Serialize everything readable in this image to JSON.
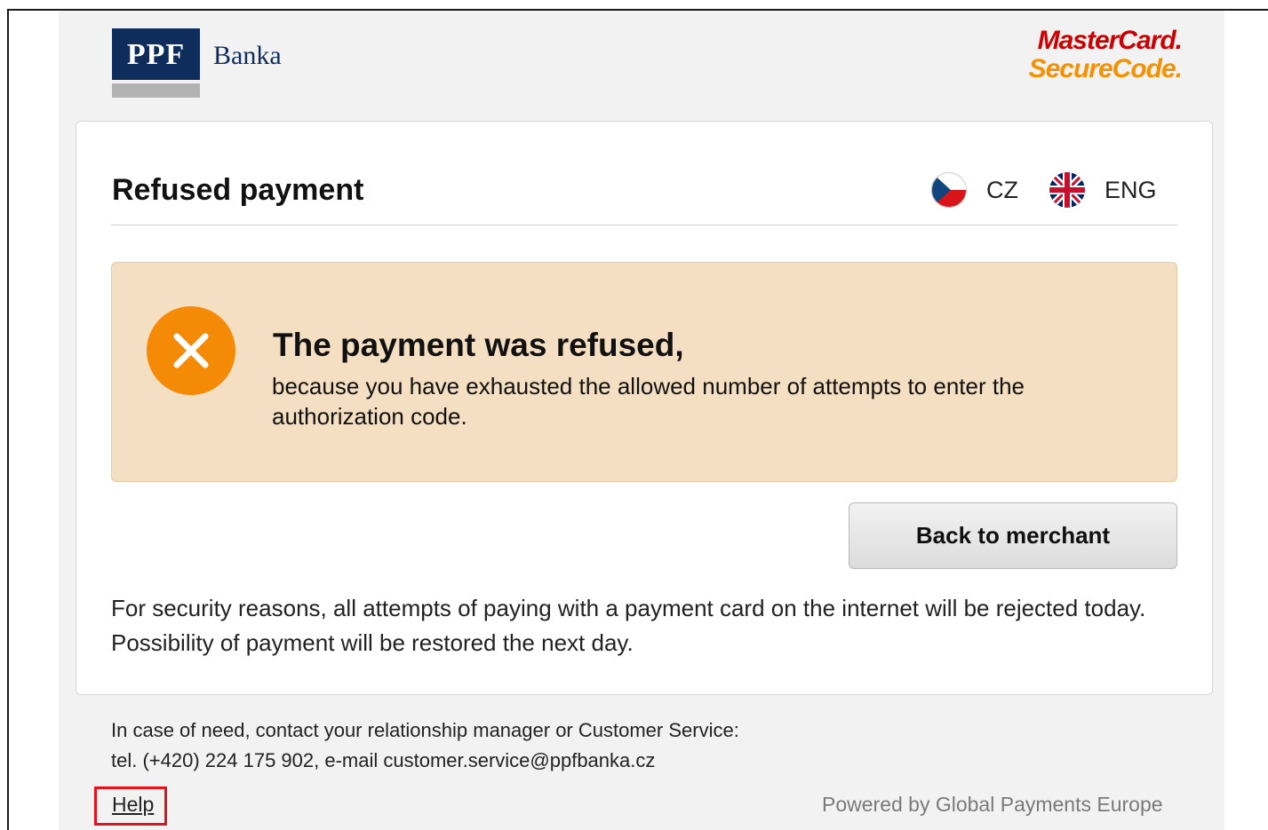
{
  "header": {
    "bank_logo_text": "PPF",
    "bank_name": "Banka",
    "mastercard_line1": "MasterCard.",
    "mastercard_line2": "SecureCode."
  },
  "card": {
    "title": "Refused payment",
    "languages": [
      {
        "code": "CZ",
        "flag_icon": "czech-flag-icon"
      },
      {
        "code": "ENG",
        "flag_icon": "uk-flag-icon"
      }
    ],
    "alert": {
      "icon": "close-icon",
      "title": "The payment was refused,",
      "text": "because you have exhausted the allowed number of attempts to enter the authorization code."
    },
    "back_button_label": "Back to merchant",
    "security_note": "For security reasons, all attempts of paying with a payment card on the internet will be rejected today. Possibility of payment will be restored the next day."
  },
  "footer": {
    "contact_line1": "In case of need, contact your relationship manager or Customer Service:",
    "contact_line2": "tel. (+420) 224 175 902, e-mail customer.service@ppfbanka.cz",
    "help_label": "Help",
    "powered_by": "Powered by Global Payments Europe"
  },
  "colors": {
    "bank_blue": "#0f2d5c",
    "alert_background": "#f5dfc2",
    "alert_icon": "#f58a07",
    "mastercard_red": "#cc0000",
    "mastercard_orange": "#f39200",
    "help_highlight": "#e3121b"
  }
}
